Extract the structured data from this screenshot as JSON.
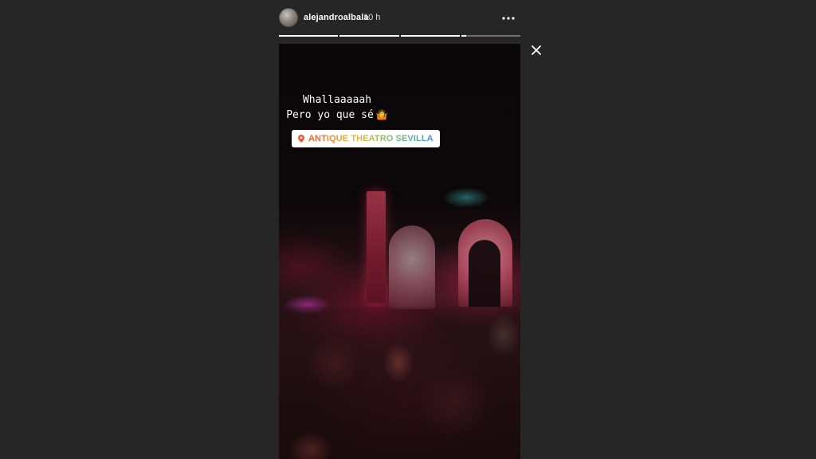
{
  "story": {
    "username": "alejandroalbala",
    "time_ago": "10 h",
    "caption": {
      "line1": "Whallaaaaah",
      "line2": "Pero yo que sé",
      "emoji": "🤷"
    },
    "location": "ANTIQUE THEATRO SEVILLA",
    "progress": [
      1,
      1,
      1,
      0.08
    ]
  },
  "icons": {
    "more": "more-horizontal-icon",
    "close": "close-icon",
    "location": "location-pin-icon"
  },
  "colors": {
    "background": "#262626",
    "progress_active": "#ffffff",
    "progress_inactive": "#5f5f5f",
    "location_gradient": [
      "#f05a28",
      "#f4b43a",
      "#7bc36a",
      "#4a8fe4"
    ]
  }
}
